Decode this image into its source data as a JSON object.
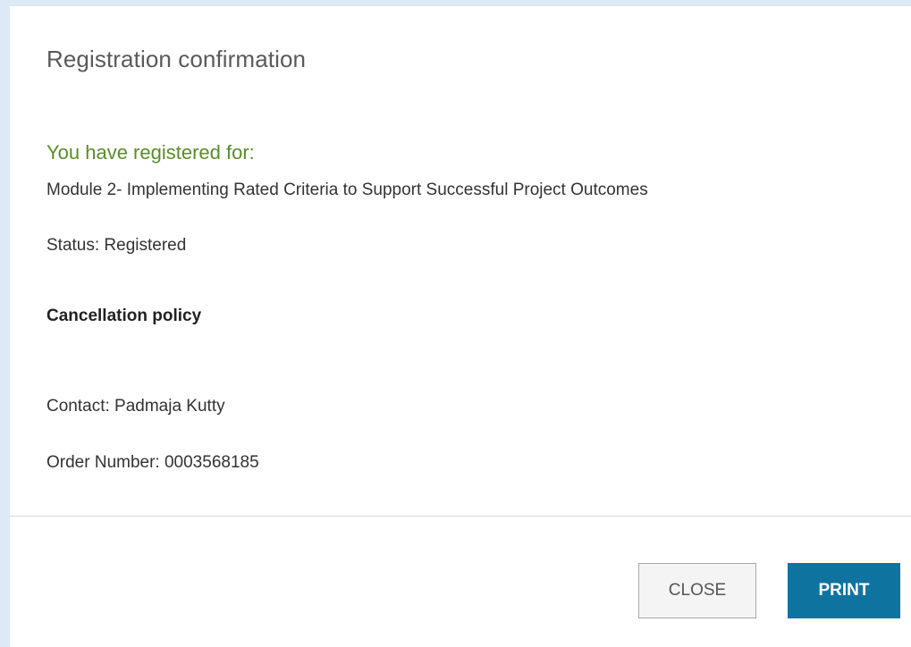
{
  "dialog": {
    "title": "Registration confirmation",
    "registered_heading": "You have registered for:",
    "course_name": "Module 2- Implementing Rated Criteria to Support Successful Project Outcomes",
    "status": "Status: Registered",
    "cancellation_policy": "Cancellation policy",
    "contact": "Contact: Padmaja Kutty",
    "order_number": "Order Number: 0003568185"
  },
  "buttons": {
    "close_label": "CLOSE",
    "print_label": "PRINT"
  },
  "colors": {
    "background": "#dde9f5",
    "heading_green": "#5b8c2a",
    "primary_button": "#0f73a0"
  }
}
